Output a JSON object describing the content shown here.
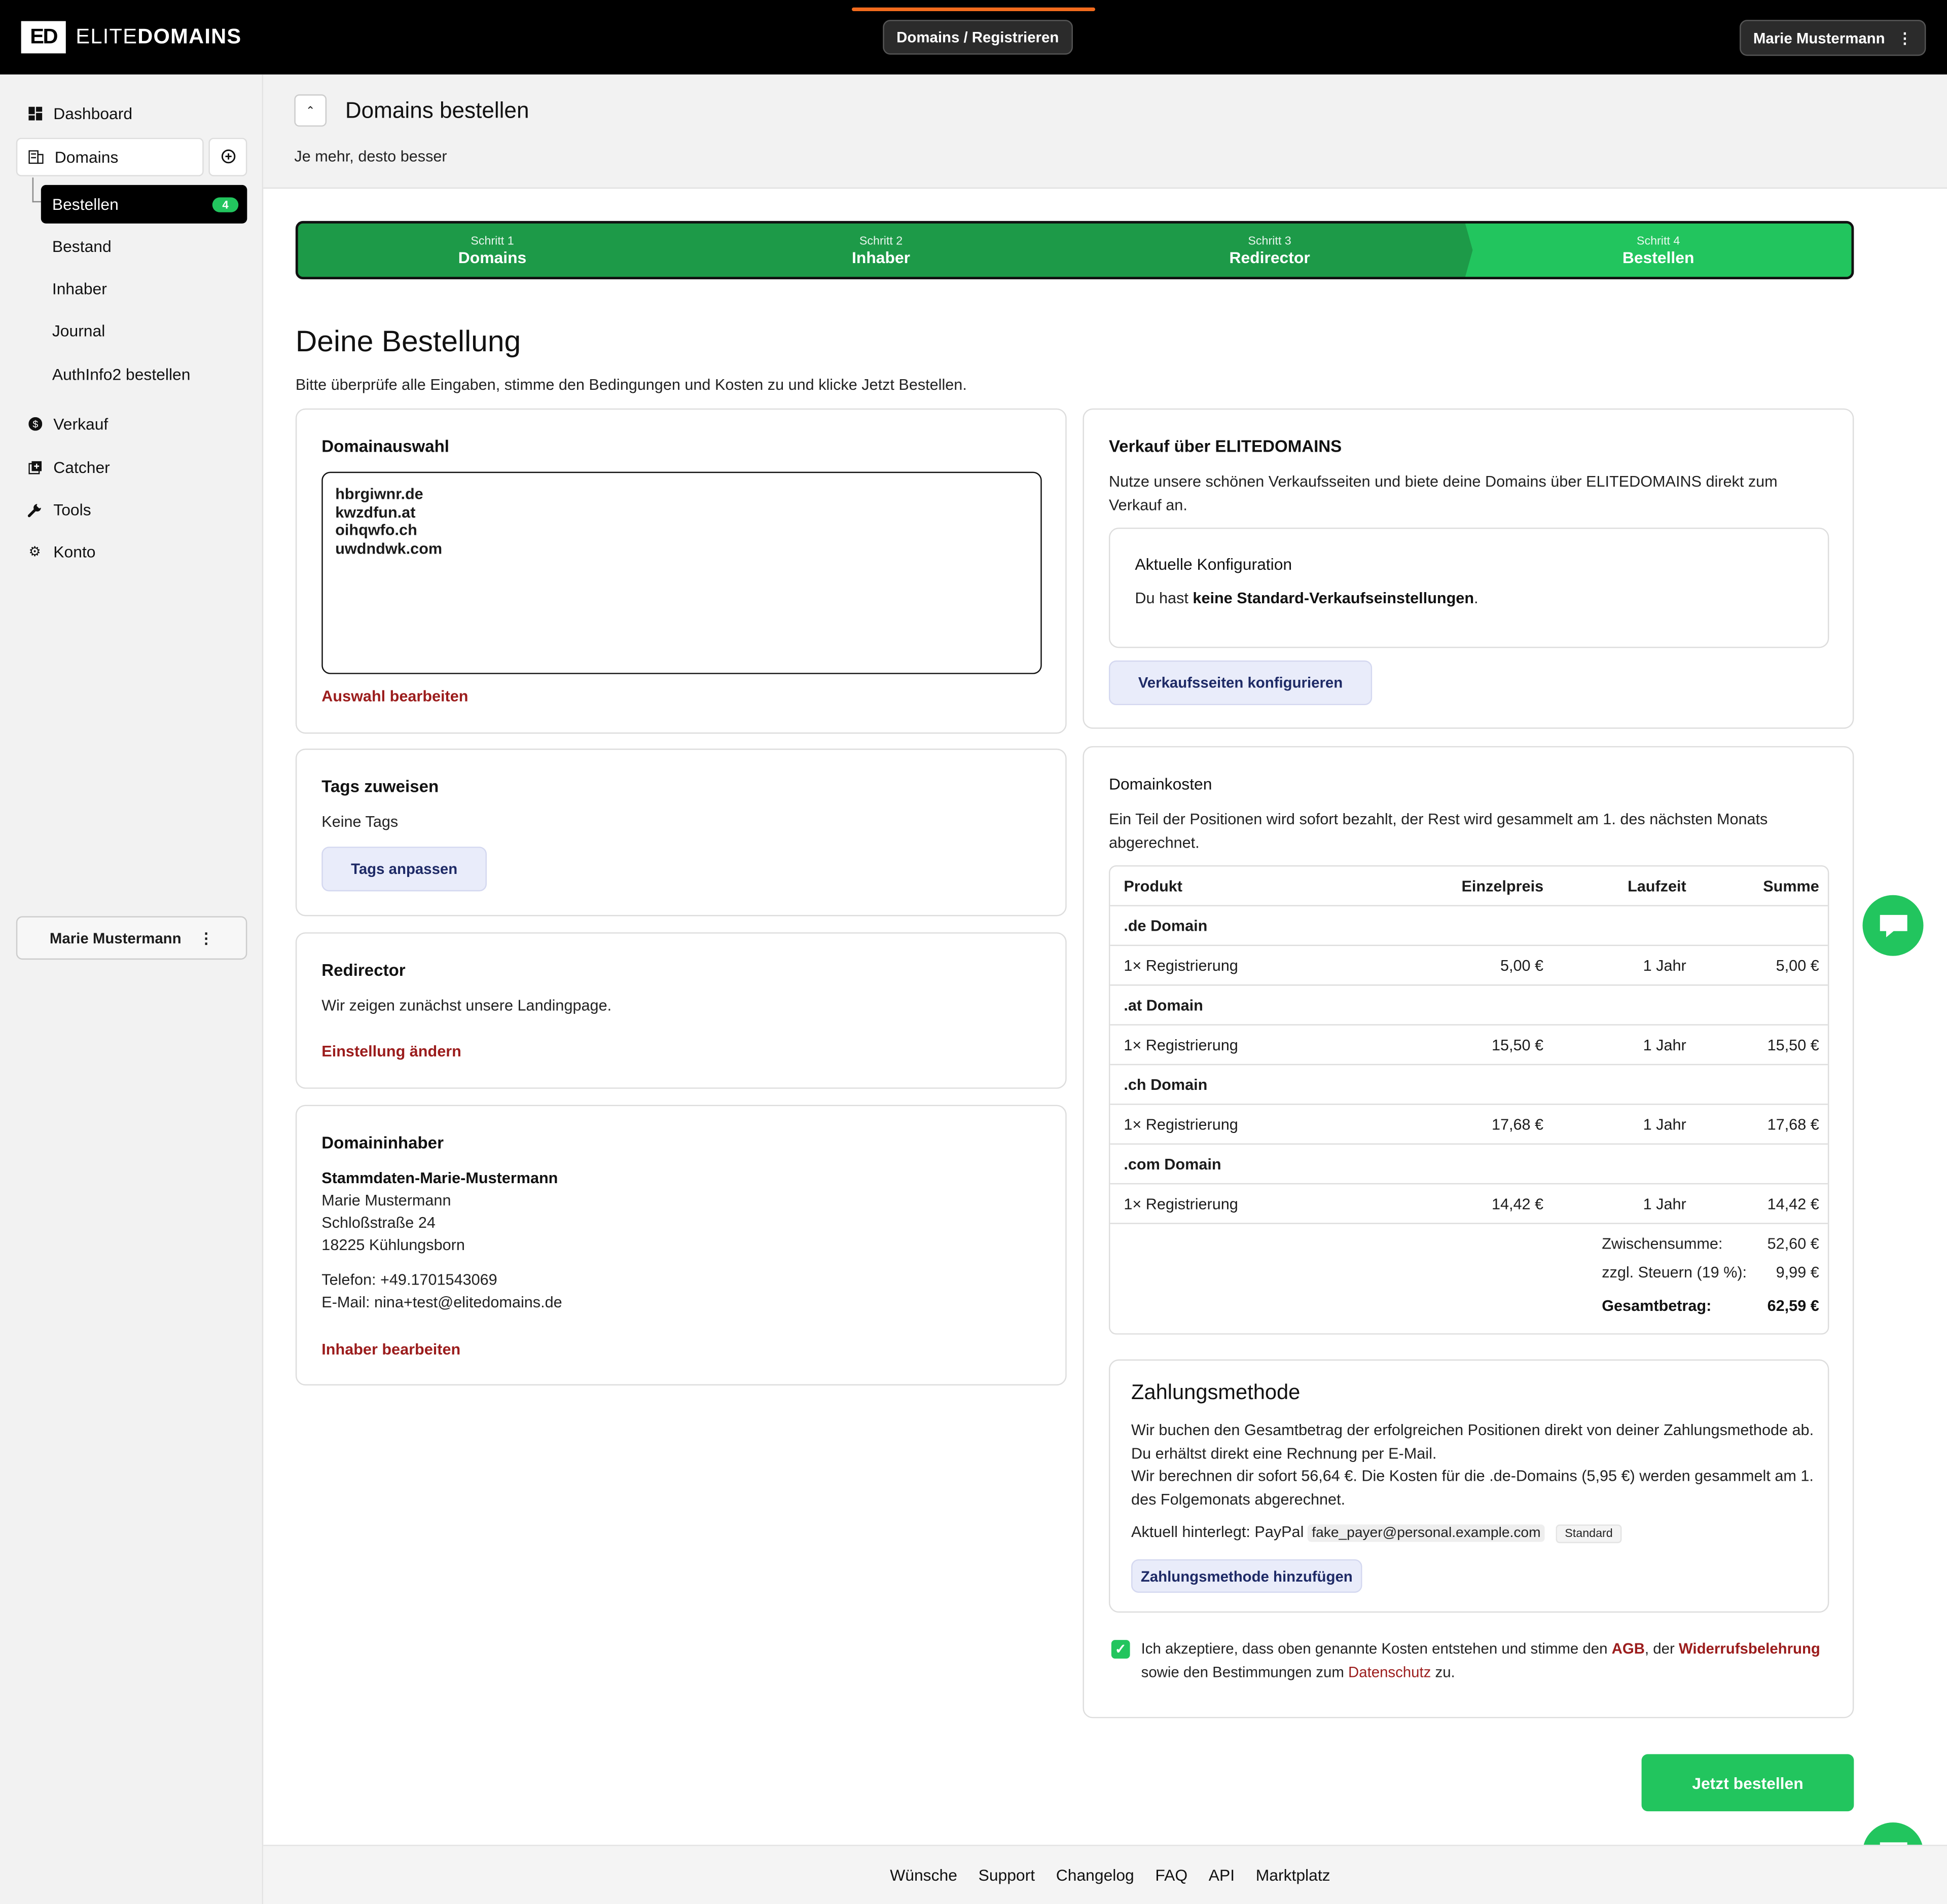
{
  "app": {
    "logo_mark": "ED",
    "logo_text_a": "ELITE",
    "logo_text_b": "DOMAINS"
  },
  "topbar": {
    "breadcrumb": "Domains / Registrieren",
    "user": "Marie Mustermann",
    "accent": "#f26b1d"
  },
  "sidebar": {
    "items": [
      {
        "label": "Dashboard",
        "icon": "dashboard-icon"
      },
      {
        "label": "Domains",
        "icon": "domains-icon"
      },
      {
        "label": "Verkauf",
        "icon": "dollar-icon"
      },
      {
        "label": "Catcher",
        "icon": "catcher-icon"
      },
      {
        "label": "Tools",
        "icon": "wrench-icon"
      },
      {
        "label": "Konto",
        "icon": "gear-icon"
      }
    ],
    "sub": [
      {
        "label": "Bestellen",
        "badge": "4"
      },
      {
        "label": "Bestand"
      },
      {
        "label": "Inhaber"
      },
      {
        "label": "Journal"
      },
      {
        "label": "AuthInfo2 bestellen"
      }
    ],
    "user": "Marie Mustermann"
  },
  "header": {
    "title": "Domains bestellen",
    "subtitle": "Je mehr, desto besser"
  },
  "steps": [
    {
      "num": "Schritt 1",
      "label": "Domains"
    },
    {
      "num": "Schritt 2",
      "label": "Inhaber"
    },
    {
      "num": "Schritt 3",
      "label": "Redirector"
    },
    {
      "num": "Schritt 4",
      "label": "Bestellen"
    }
  ],
  "order": {
    "title": "Deine Bestellung",
    "intro": "Bitte überprüfe alle Eingaben, stimme den Bedingungen und Kosten zu und klicke Jetzt Bestellen."
  },
  "domain_selection": {
    "title": "Domainauswahl",
    "domains": [
      "hbrgiwnr.de",
      "kwzdfun.at",
      "oihqwfo.ch",
      "uwdndwk.com"
    ],
    "edit_link": "Auswahl bearbeiten"
  },
  "tags": {
    "title": "Tags zuweisen",
    "value": "Keine Tags",
    "button": "Tags anpassen"
  },
  "redirector": {
    "title": "Redirector",
    "text": "Wir zeigen zunächst unsere Landingpage.",
    "link": "Einstellung ändern"
  },
  "owner": {
    "title": "Domaininhaber",
    "handle": "Stammdaten-Marie-Mustermann",
    "name": "Marie Mustermann",
    "street": "Schloßstraße 24",
    "city": "18225 Kühlungsborn",
    "phone": "Telefon: +49.1701543069",
    "email": "E-Mail: nina+test@elitedomains.de",
    "link": "Inhaber bearbeiten"
  },
  "sale": {
    "title": "Verkauf über ELITEDOMAINS",
    "text": "Nutze unsere schönen Verkaufsseiten und biete deine Domains über ELITEDOMAINS direkt zum Verkauf an.",
    "config_title": "Aktuelle Konfiguration",
    "config_prefix": "Du hast ",
    "config_bold": "keine Standard-Verkaufseinstellungen",
    "config_suffix": ".",
    "button": "Verkaufsseiten konfigurieren"
  },
  "costs": {
    "title": "Domainkosten",
    "text": "Ein Teil der Positionen wird sofort bezahlt, der Rest wird gesammelt am 1. des nächsten Monats abgerechnet.",
    "headers": [
      "Produkt",
      "Einzelpreis",
      "Laufzeit",
      "Summe"
    ],
    "groups": [
      {
        "name": ".de Domain",
        "item": "1× Registrierung",
        "price": "5,00 €",
        "term": "1 Jahr",
        "sum": "5,00 €"
      },
      {
        "name": ".at Domain",
        "item": "1× Registrierung",
        "price": "15,50 €",
        "term": "1 Jahr",
        "sum": "15,50 €"
      },
      {
        "name": ".ch Domain",
        "item": "1× Registrierung",
        "price": "17,68 €",
        "term": "1 Jahr",
        "sum": "17,68 €"
      },
      {
        "name": ".com Domain",
        "item": "1× Registrierung",
        "price": "14,42 €",
        "term": "1 Jahr",
        "sum": "14,42 €"
      }
    ],
    "subtotal_label": "Zwischensumme:",
    "subtotal": "52,60 €",
    "tax_label": "zzgl. Steuern (19 %):",
    "tax": "9,99 €",
    "total_label": "Gesamtbetrag:",
    "total": "62,59 €"
  },
  "payment": {
    "title": "Zahlungsmethode",
    "text1": "Wir buchen den Gesamtbetrag der erfolgreichen Positionen direkt von deiner Zahlungsmethode ab. Du erhältst direkt eine Rechnung per E-Mail.",
    "text2": "Wir berechnen dir sofort 56,64 €. Die Kosten für die .de-Domains (5,95 €) werden gesammelt am 1. des Folgemonats abgerechnet.",
    "current_prefix": "Aktuell hinterlegt: PayPal",
    "account": "fake_payer@personal.example.com",
    "standard": "Standard",
    "button": "Zahlungsmethode hinzufügen"
  },
  "terms": {
    "checked": true,
    "t1": "Ich akzeptiere, dass oben genannte Kosten entstehen und stimme den ",
    "agb": "AGB",
    "t2": ", der ",
    "widerruf": "Widerrufsbelehrung",
    "t3": " sowie den Bestimmungen zum ",
    "datenschutz": "Datenschutz",
    "t4": " zu."
  },
  "order_button": "Jetzt bestellen",
  "footer": [
    "Wünsche",
    "Support",
    "Changelog",
    "FAQ",
    "API",
    "Marktplatz"
  ],
  "colors": {
    "green": "#22c55e",
    "dark_green": "#1d9a48",
    "link_red": "#9b1c1c"
  }
}
